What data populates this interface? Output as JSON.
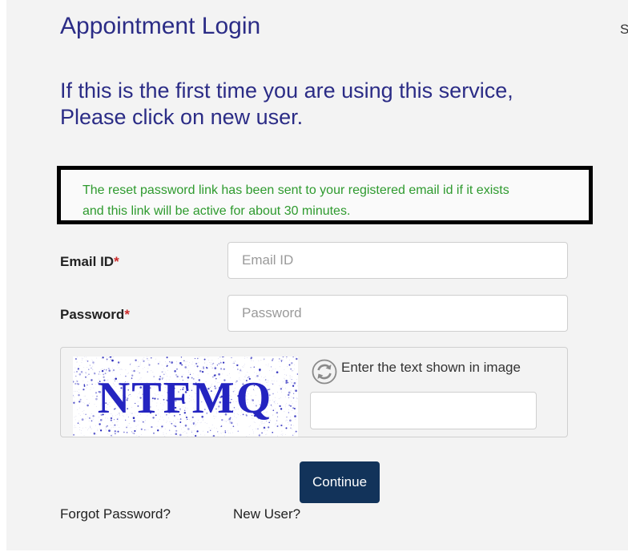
{
  "header": {
    "title": "Appointment Login",
    "side_text": "Se"
  },
  "intro": {
    "line1": "If this is the first time you are using this service,",
    "line2": "Please click on new user."
  },
  "notice": {
    "line1": "The reset password link has been sent to your registered email id if it exists",
    "line2": "and this link will be active for about 30 minutes."
  },
  "form": {
    "email": {
      "label": "Email ID",
      "required_mark": "*",
      "placeholder": "Email ID",
      "value": ""
    },
    "password": {
      "label": "Password",
      "required_mark": "*",
      "placeholder": "Password",
      "value": ""
    },
    "captcha": {
      "image_text": "NTFMQ",
      "label": "Enter the text shown in image",
      "value": "",
      "refresh_icon": "refresh-icon"
    },
    "continue_label": "Continue"
  },
  "links": {
    "forgot_password": "Forgot Password?",
    "new_user": "New User?"
  },
  "colors": {
    "heading": "#2b2c86",
    "notice_text": "#2e9a2e",
    "required": "#cc2a2a",
    "button": "#12335a",
    "captcha_text": "#1a1ab8"
  }
}
